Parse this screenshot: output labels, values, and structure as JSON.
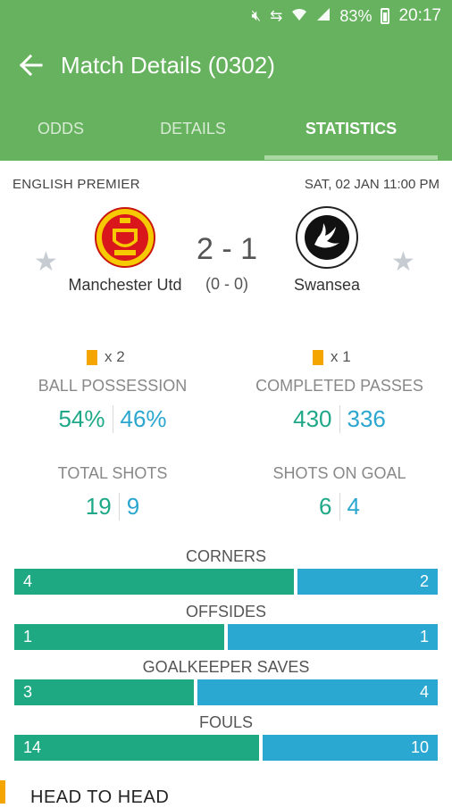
{
  "status_bar": {
    "battery": "83%",
    "time": "20:17",
    "icons": [
      "mute-icon",
      "data-transfer-icon",
      "wifi-icon",
      "signal-icon",
      "battery-icon"
    ]
  },
  "header": {
    "title": "Match Details (0302)",
    "tabs": [
      {
        "label": "ODDS",
        "active": false
      },
      {
        "label": "DETAILS",
        "active": false
      },
      {
        "label": "STATISTICS",
        "active": true
      }
    ]
  },
  "match": {
    "league": "ENGLISH PREMIER",
    "datetime": "SAT, 02 JAN 11:00 PM",
    "home": {
      "name": "Manchester Utd",
      "yellow_cards": "x 2"
    },
    "away": {
      "name": "Swansea",
      "yellow_cards": "x 1"
    },
    "score": "2 - 1",
    "halftime": "(0 - 0)"
  },
  "stats": {
    "ball_possession": {
      "label": "BALL POSSESSION",
      "home": "54%",
      "away": "46%"
    },
    "completed_passes": {
      "label": "COMPLETED PASSES",
      "home": "430",
      "away": "336"
    },
    "total_shots": {
      "label": "TOTAL SHOTS",
      "home": "19",
      "away": "9"
    },
    "shots_on_goal": {
      "label": "SHOTS ON GOAL",
      "home": "6",
      "away": "4"
    }
  },
  "bars": [
    {
      "label": "CORNERS",
      "home": "4",
      "away": "2",
      "home_value": 4,
      "away_value": 2
    },
    {
      "label": "OFFSIDES",
      "home": "1",
      "away": "1",
      "home_value": 1,
      "away_value": 1
    },
    {
      "label": "GOALKEEPER SAVES",
      "home": "3",
      "away": "4",
      "home_value": 3,
      "away_value": 4
    },
    {
      "label": "FOULS",
      "home": "14",
      "away": "10",
      "home_value": 14,
      "away_value": 10
    }
  ],
  "head_to_head": {
    "label": "HEAD TO HEAD"
  },
  "colors": {
    "header_green": "#66b25e",
    "home_color": "#1fa982",
    "away_color": "#2aa8d2",
    "card_yellow": "#f5a500"
  }
}
